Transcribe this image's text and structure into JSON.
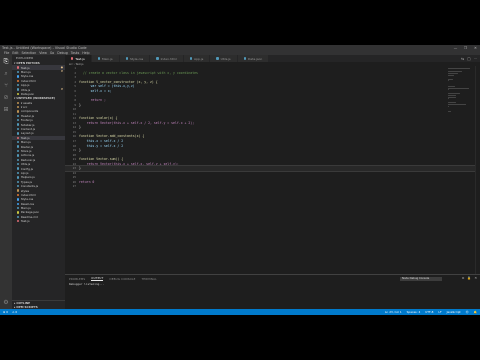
{
  "window": {
    "title": "Test.js - Untitled (Workspace) - Visual Studio Code",
    "controls": [
      "—",
      "❐",
      "✕"
    ]
  },
  "menu": [
    "File",
    "Edit",
    "Selection",
    "View",
    "Go",
    "Debug",
    "Tasks",
    "Help"
  ],
  "activity_bar": [
    {
      "icon": "files-icon",
      "glyph": "⎘",
      "active": true
    },
    {
      "icon": "search-icon",
      "glyph": "⌕",
      "active": false
    },
    {
      "icon": "source-control-icon",
      "glyph": "⑂",
      "active": false
    },
    {
      "icon": "debug-icon",
      "glyph": "⊘",
      "active": false
    },
    {
      "icon": "extensions-icon",
      "glyph": "⊞",
      "active": false
    }
  ],
  "manage_icon": {
    "icon": "gear-icon",
    "glyph": "⚙"
  },
  "sidebar": {
    "title": "EXPLORER",
    "open_editors_section": "▾ OPEN EDITORS",
    "open_editors": [
      {
        "label": "Test.js",
        "color": "#e06c75",
        "badge": "●",
        "selected": true
      },
      {
        "label": "Main.js",
        "color": "#519aba",
        "badge": "M"
      },
      {
        "label": "Style.css",
        "color": "#42a5f5",
        "badge": ""
      },
      {
        "label": "Index.html",
        "color": "#e37933",
        "badge": ""
      },
      {
        "label": "App.js",
        "color": "#519aba",
        "badge": ""
      },
      {
        "label": "Utils.js",
        "color": "#519aba",
        "badge": "M"
      },
      {
        "label": "Data.json",
        "color": "#cbcb41",
        "badge": ""
      }
    ],
    "workspace_section": "▾ UNTITLED (WORKSPACE)",
    "files": [
      {
        "label": "▾ assets",
        "color": "#c09553"
      },
      {
        "label": "▾ src",
        "color": "#c09553"
      },
      {
        "label": "components",
        "color": "#c09553"
      },
      {
        "label": "Header.js",
        "color": "#519aba"
      },
      {
        "label": "Footer.js",
        "color": "#519aba"
      },
      {
        "label": "Sidebar.js",
        "color": "#519aba"
      },
      {
        "label": "Content.js",
        "color": "#519aba"
      },
      {
        "label": "Layout.js",
        "color": "#519aba"
      },
      {
        "label": "Test.js",
        "color": "#e06c75",
        "selected": true
      },
      {
        "label": "Main.js",
        "color": "#519aba"
      },
      {
        "label": "Router.js",
        "color": "#519aba"
      },
      {
        "label": "Store.js",
        "color": "#519aba"
      },
      {
        "label": "Actions.js",
        "color": "#519aba"
      },
      {
        "label": "Reducer.js",
        "color": "#519aba"
      },
      {
        "label": "Utils.js",
        "color": "#519aba"
      },
      {
        "label": "Config.js",
        "color": "#519aba"
      },
      {
        "label": "Api.js",
        "color": "#519aba"
      },
      {
        "label": "Helpers.js",
        "color": "#519aba"
      },
      {
        "label": "Types.js",
        "color": "#519aba"
      },
      {
        "label": "Constants.js",
        "color": "#519aba"
      },
      {
        "label": "styles",
        "color": "#c09553"
      },
      {
        "label": "Index.html",
        "color": "#e37933"
      },
      {
        "label": "Style.css",
        "color": "#42a5f5"
      },
      {
        "label": "Reset.css",
        "color": "#42a5f5"
      },
      {
        "label": "Main.js",
        "color": "#519aba"
      },
      {
        "label": "Package.json",
        "color": "#cbcb41"
      },
      {
        "label": "Readme.md",
        "color": "#519aba"
      },
      {
        "label": "Test.js",
        "color": "#e06c75"
      }
    ],
    "outline_section": "▸ OUTLINE",
    "timeline_section": "▸ NPM SCRIPTS"
  },
  "tabs": [
    {
      "label": "Test.js",
      "active": true
    },
    {
      "label": "Main.js"
    },
    {
      "label": "Style.css"
    },
    {
      "label": "Index.html"
    },
    {
      "label": "App.js"
    },
    {
      "label": "Utils.js"
    },
    {
      "label": "Data.json"
    }
  ],
  "tab_actions": [
    "⇆",
    "□",
    "⋯"
  ],
  "breadcrumb": "src › Test.js",
  "code_lines": [
    {
      "n": "1",
      "t": "",
      "c": "code"
    },
    {
      "n": "2",
      "t": "  // create a vector class in javascript with x, y coordinates",
      "c": "cm"
    },
    {
      "n": "3",
      "t": "",
      "c": "code"
    },
    {
      "n": "4",
      "t": "function V_vector_constructor (x, y, z) {",
      "c": "fn"
    },
    {
      "n": "5",
      "t": "      var self = (this.x,y,z)",
      "c": "vr"
    },
    {
      "n": "6",
      "t": "      self.x = x;",
      "c": "vr"
    },
    {
      "n": "7",
      "t": "",
      "c": "code"
    },
    {
      "n": "8",
      "t": "      return ;",
      "c": "kw"
    },
    {
      "n": "9",
      "t": "}",
      "c": "code"
    },
    {
      "n": "10",
      "t": "",
      "c": "code"
    },
    {
      "n": "11",
      "t": "",
      "c": "code"
    },
    {
      "n": "12",
      "t": "function scalar(x) {",
      "c": "fn"
    },
    {
      "n": "13",
      "t": "    return Vector(this.x + self.x / 2, self.y = self.x + 2);",
      "c": "kw"
    },
    {
      "n": "14",
      "t": "}",
      "c": "code"
    },
    {
      "n": "15",
      "t": "",
      "c": "code"
    },
    {
      "n": "16",
      "t": "function Vector.add_constants(x) {",
      "c": "fn"
    },
    {
      "n": "17",
      "t": "    this.x = self.x / 2",
      "c": "vr"
    },
    {
      "n": "18",
      "t": "    this.y = self.x / 2",
      "c": "vr"
    },
    {
      "n": "19",
      "t": "}",
      "c": "code"
    },
    {
      "n": "20",
      "t": "",
      "c": "code"
    },
    {
      "n": "21",
      "t": "function Vector.sum() {",
      "c": "fn"
    },
    {
      "n": "22",
      "t": "    return Vector(this.x + self.x, self.y + self.y);",
      "c": "kw"
    },
    {
      "n": "23",
      "t": "}",
      "c": "code",
      "current": true
    },
    {
      "n": "24",
      "t": "",
      "c": "code"
    },
    {
      "n": "25",
      "t": "",
      "c": "code"
    },
    {
      "n": "26",
      "t": "return 0",
      "c": "kw"
    },
    {
      "n": "27",
      "t": "",
      "c": "code"
    }
  ],
  "panel": {
    "tabs": [
      "PROBLEMS",
      "OUTPUT",
      "DEBUG CONSOLE",
      "TERMINAL"
    ],
    "active_tab": 1,
    "select_value": "Node Debug Console",
    "actions": [
      "≡",
      "🔒",
      "✕"
    ],
    "output": "Debugger listening..."
  },
  "statusbar": {
    "left": [
      "⊗ 0",
      "⚠ 0"
    ],
    "right": [
      "Ln 23, Col 1",
      "Spaces: 4",
      "UTF-8",
      "LF",
      "JavaScript",
      "☺",
      "🔔"
    ]
  }
}
